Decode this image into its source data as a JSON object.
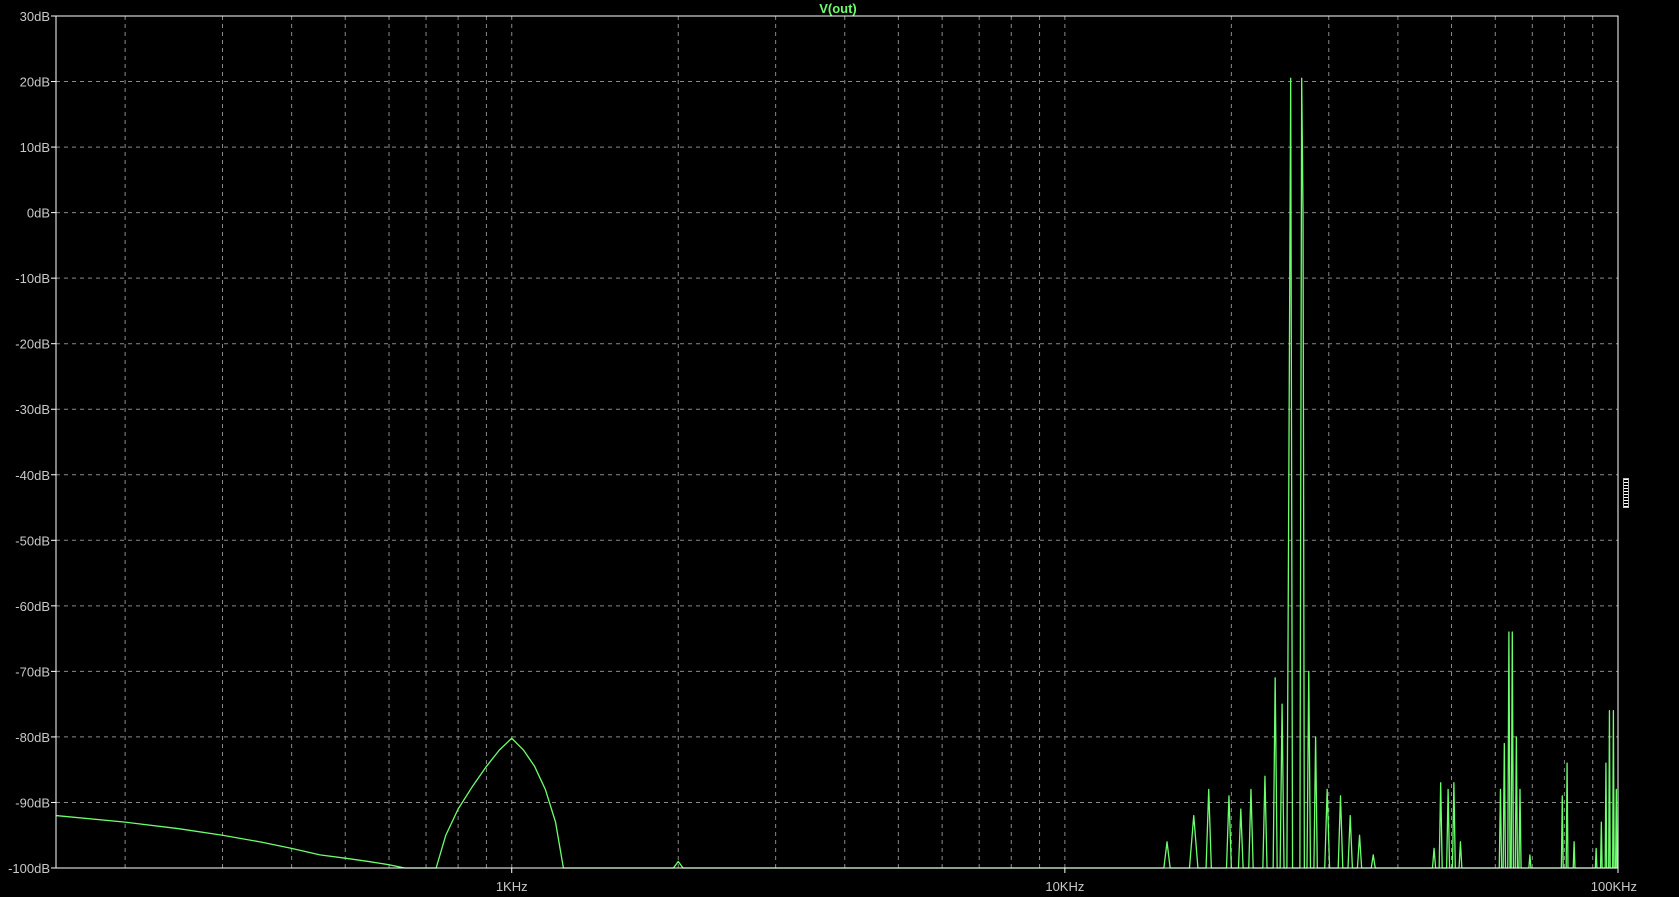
{
  "chart_data": {
    "type": "line",
    "title": "V(out)",
    "colors": {
      "background": "#000000",
      "trace": "#6CFF6C",
      "grid": "#8A8A8A",
      "frame": "#FFFFFF",
      "tick_text": "#C8C8C8"
    },
    "x_scale": "log",
    "xlim": [
      150,
      100000
    ],
    "ylim": [
      -100,
      30
    ],
    "grid": true,
    "y_ticks": [
      {
        "value": 30,
        "label": "30dB"
      },
      {
        "value": 20,
        "label": "20dB"
      },
      {
        "value": 10,
        "label": "10dB"
      },
      {
        "value": 0,
        "label": "0dB"
      },
      {
        "value": -10,
        "label": "-10dB"
      },
      {
        "value": -20,
        "label": "-20dB"
      },
      {
        "value": -30,
        "label": "-30dB"
      },
      {
        "value": -40,
        "label": "-40dB"
      },
      {
        "value": -50,
        "label": "-50dB"
      },
      {
        "value": -60,
        "label": "-60dB"
      },
      {
        "value": -70,
        "label": "-70dB"
      },
      {
        "value": -80,
        "label": "-80dB"
      },
      {
        "value": -90,
        "label": "-90dB"
      },
      {
        "value": -100,
        "label": "-100dB"
      }
    ],
    "x_ticks": [
      {
        "value": 1000,
        "label": "1KHz"
      },
      {
        "value": 10000,
        "label": "10KHz"
      },
      {
        "value": 100000,
        "label": "100KHz"
      }
    ],
    "series": [
      {
        "name": "V(out)",
        "points": [
          [
            150,
            -92.0
          ],
          [
            200,
            -93.0
          ],
          [
            250,
            -94.0
          ],
          [
            300,
            -95.0
          ],
          [
            350,
            -96.0
          ],
          [
            400,
            -97.0
          ],
          [
            450,
            -98.0
          ],
          [
            500,
            -98.5
          ],
          [
            550,
            -99.0
          ],
          [
            600,
            -99.5
          ],
          [
            640,
            -100.0
          ],
          [
            730,
            -100.0
          ],
          [
            760,
            -95.0
          ],
          [
            800,
            -91.0
          ],
          [
            850,
            -87.5
          ],
          [
            900,
            -84.5
          ],
          [
            950,
            -82.0
          ],
          [
            1000,
            -80.2
          ],
          [
            1050,
            -82.0
          ],
          [
            1100,
            -84.5
          ],
          [
            1150,
            -88.0
          ],
          [
            1200,
            -93.0
          ],
          [
            1240,
            -100.0
          ],
          [
            1960,
            -100.0
          ],
          [
            2000,
            -99.0
          ],
          [
            2040,
            -100.0
          ],
          [
            15100,
            -100.0
          ],
          [
            15300,
            -96.0
          ],
          [
            15500,
            -100.0
          ],
          [
            16800,
            -100.0
          ],
          [
            17100,
            -92.0
          ],
          [
            17400,
            -100.0
          ],
          [
            18000,
            -100.0
          ],
          [
            18200,
            -88.0
          ],
          [
            18400,
            -100.0
          ],
          [
            19600,
            -100.0
          ],
          [
            19800,
            -89.0
          ],
          [
            20000,
            -100.0
          ],
          [
            20600,
            -100.0
          ],
          [
            20800,
            -91.0
          ],
          [
            21000,
            -100.0
          ],
          [
            21500,
            -100.0
          ],
          [
            21700,
            -88.0
          ],
          [
            21900,
            -100.0
          ],
          [
            22800,
            -100.0
          ],
          [
            23000,
            -86.0
          ],
          [
            23200,
            -100.0
          ],
          [
            23800,
            -100.0
          ],
          [
            24000,
            -71.0
          ],
          [
            24200,
            -100.0
          ],
          [
            24500,
            -100.0
          ],
          [
            24700,
            -75.0
          ],
          [
            24900,
            -100.0
          ],
          [
            25200,
            -100.0
          ],
          [
            25400,
            -42.0
          ],
          [
            25600,
            20.5
          ],
          [
            25800,
            -100.0
          ],
          [
            26600,
            -100.0
          ],
          [
            26800,
            20.5
          ],
          [
            26950,
            0.0
          ],
          [
            27100,
            -100.0
          ],
          [
            27400,
            -100.0
          ],
          [
            27600,
            -70.0
          ],
          [
            27800,
            -100.0
          ],
          [
            28200,
            -100.0
          ],
          [
            28400,
            -80.0
          ],
          [
            28600,
            -100.0
          ],
          [
            29500,
            -100.0
          ],
          [
            29800,
            -88.0
          ],
          [
            30100,
            -100.0
          ],
          [
            31200,
            -100.0
          ],
          [
            31500,
            -89.0
          ],
          [
            31800,
            -100.0
          ],
          [
            32500,
            -100.0
          ],
          [
            32800,
            -92.0
          ],
          [
            33100,
            -100.0
          ],
          [
            33800,
            -100.0
          ],
          [
            34100,
            -95.0
          ],
          [
            34400,
            -100.0
          ],
          [
            35800,
            -100.0
          ],
          [
            36100,
            -98.0
          ],
          [
            36400,
            -100.0
          ],
          [
            46200,
            -100.0
          ],
          [
            46500,
            -97.0
          ],
          [
            46800,
            -100.0
          ],
          [
            47500,
            -100.0
          ],
          [
            47800,
            -87.0
          ],
          [
            48100,
            -100.0
          ],
          [
            49000,
            -100.0
          ],
          [
            49300,
            -88.0
          ],
          [
            49600,
            -100.0
          ],
          [
            50200,
            -100.0
          ],
          [
            50500,
            -87.0
          ],
          [
            50800,
            -100.0
          ],
          [
            51600,
            -100.0
          ],
          [
            51900,
            -96.0
          ],
          [
            52200,
            -100.0
          ],
          [
            61000,
            -100.0
          ],
          [
            61300,
            -88.0
          ],
          [
            61600,
            -100.0
          ],
          [
            62000,
            -100.0
          ],
          [
            62300,
            -81.0
          ],
          [
            62600,
            -100.0
          ],
          [
            63200,
            -100.0
          ],
          [
            63500,
            -64.0
          ],
          [
            63800,
            -100.0
          ],
          [
            64100,
            -100.0
          ],
          [
            64400,
            -64.0
          ],
          [
            64700,
            -100.0
          ],
          [
            65200,
            -100.0
          ],
          [
            65500,
            -80.0
          ],
          [
            65800,
            -100.0
          ],
          [
            66200,
            -100.0
          ],
          [
            66500,
            -88.0
          ],
          [
            66800,
            -100.0
          ],
          [
            69000,
            -100.0
          ],
          [
            69300,
            -98.0
          ],
          [
            69600,
            -100.0
          ],
          [
            79000,
            -100.0
          ],
          [
            79300,
            -89.0
          ],
          [
            79600,
            -100.0
          ],
          [
            80600,
            -100.0
          ],
          [
            80900,
            -84.0
          ],
          [
            81200,
            -100.0
          ],
          [
            83000,
            -100.0
          ],
          [
            83300,
            -96.0
          ],
          [
            83600,
            -100.0
          ],
          [
            91000,
            -100.0
          ],
          [
            91300,
            -97.0
          ],
          [
            91600,
            -100.0
          ],
          [
            93000,
            -100.0
          ],
          [
            93300,
            -93.0
          ],
          [
            93600,
            -100.0
          ],
          [
            94800,
            -100.0
          ],
          [
            95100,
            -84.0
          ],
          [
            95400,
            -100.0
          ],
          [
            96200,
            -100.0
          ],
          [
            96500,
            -76.0
          ],
          [
            96800,
            -100.0
          ],
          [
            97800,
            -100.0
          ],
          [
            98100,
            -76.0
          ],
          [
            98400,
            -100.0
          ],
          [
            99000,
            -100.0
          ],
          [
            99300,
            -88.0
          ],
          [
            99600,
            -100.0
          ]
        ]
      }
    ]
  }
}
